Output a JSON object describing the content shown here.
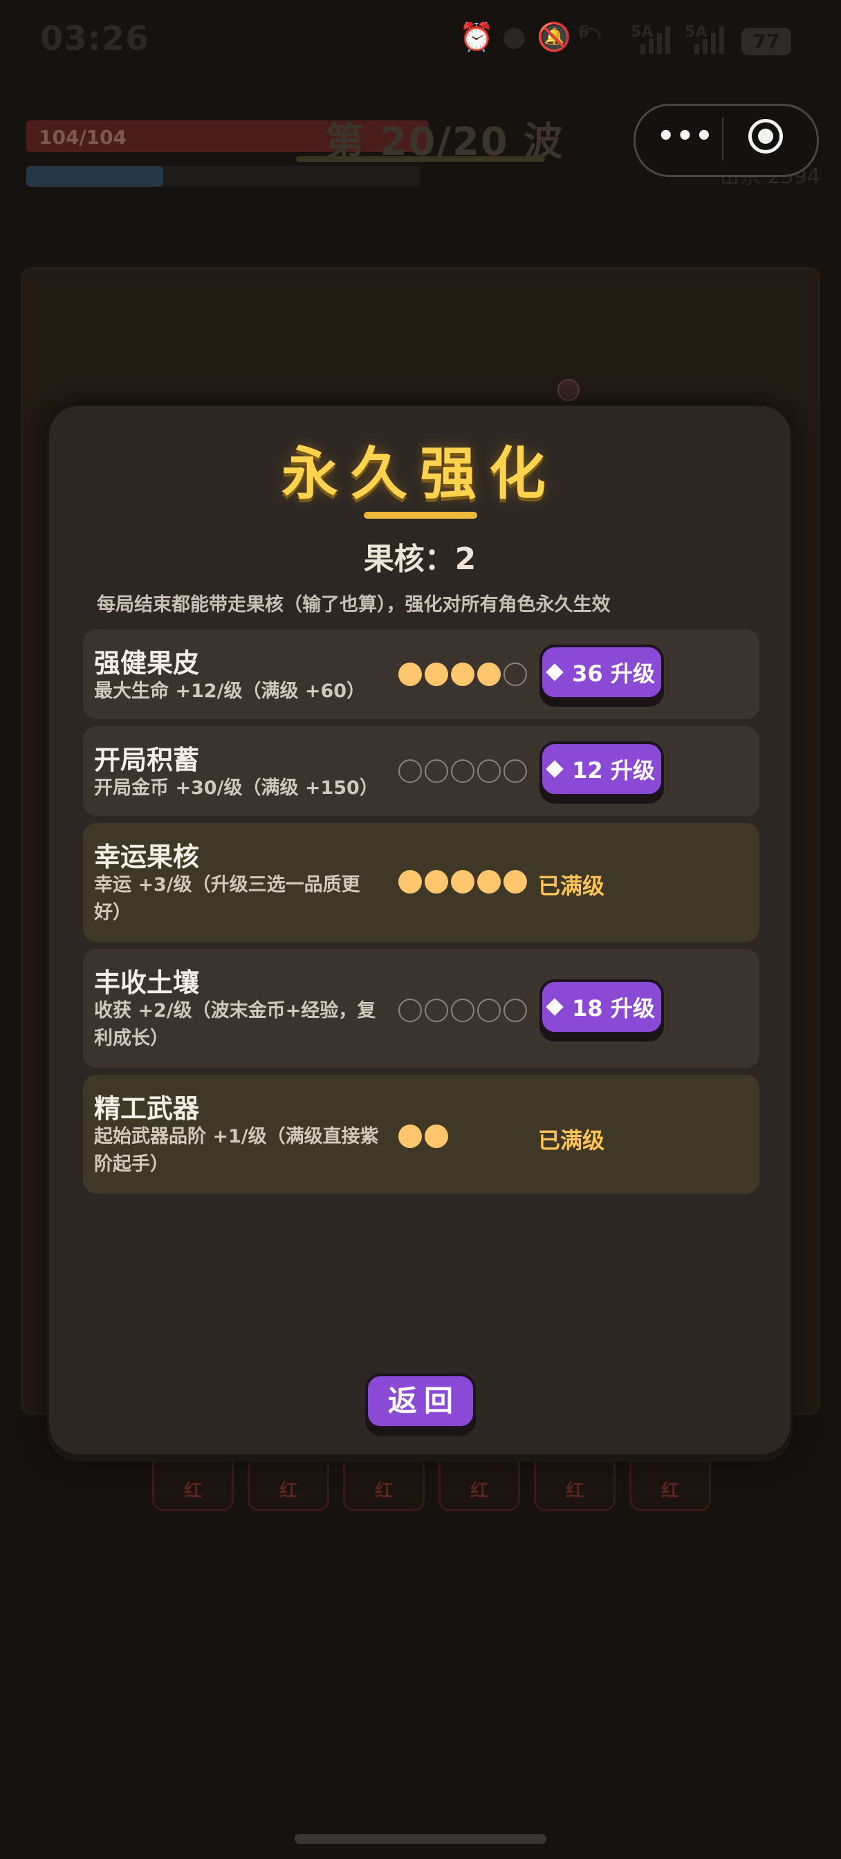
{
  "status_bar": {
    "time": "03:26",
    "icons": [
      "alarm-icon",
      "location-icon",
      "mute-icon",
      "wifi-icon",
      "signal-icon",
      "signal-icon"
    ],
    "net_labels": [
      "6",
      "5A",
      "5A"
    ],
    "battery": "77"
  },
  "hud": {
    "hp_text": "104/104",
    "wave_text": "第 20/20 波",
    "kills_text": "击杀 2594"
  },
  "modal": {
    "title": "永久强化",
    "core_label": "果核：2",
    "description": "每局结束都能带走果核（输了也算），强化对所有角色永久生效",
    "upgrades": [
      {
        "name": "强健果皮",
        "desc": "最大生命 +12/级（满级 +60）",
        "level": 4,
        "max": 5,
        "button": "36 升级"
      },
      {
        "name": "开局积蓄",
        "desc": "开局金币 +30/级（满级 +150）",
        "level": 0,
        "max": 5,
        "button": "12 升级"
      },
      {
        "name": "幸运果核",
        "desc": "幸运 +3/级（升级三选一品质更好）",
        "level": 5,
        "max": 5,
        "status": "已满级"
      },
      {
        "name": "丰收土壤",
        "desc": "收获 +2/级（波末金币+经验，复利成长）",
        "level": 0,
        "max": 5,
        "button": "18 升级"
      },
      {
        "name": "精工武器",
        "desc": "起始武器品阶 +1/级（满级直接紫阶起手）",
        "level": 2,
        "max": 2,
        "status": "已满级"
      }
    ],
    "back_label": "返回"
  },
  "weapon_slots": [
    "红",
    "红",
    "红",
    "红",
    "红",
    "红"
  ],
  "colors": {
    "accent_gold": "#ffd34d",
    "button_purple": "#8a4ad6",
    "pip_full": "#ffc66e",
    "maxed_text": "#ffc35a"
  }
}
